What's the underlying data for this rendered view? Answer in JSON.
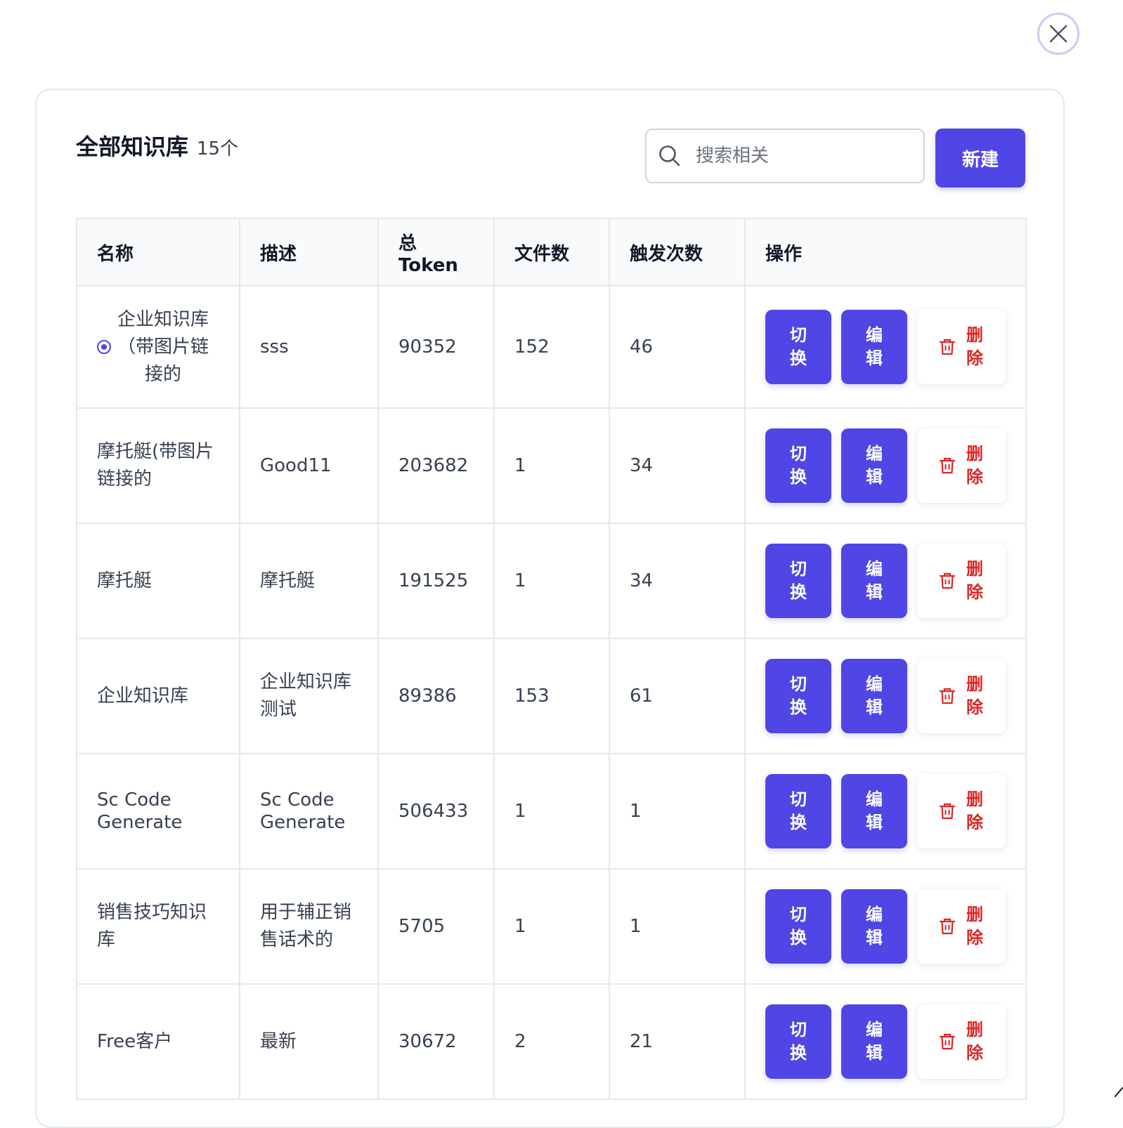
{
  "header": {
    "title": "全部知识库",
    "count": "15个"
  },
  "search": {
    "placeholder": "搜索相关"
  },
  "toolbar": {
    "new_label": "新建"
  },
  "icons": {
    "close": "close-icon",
    "search": "search-icon",
    "trash": "trash-icon",
    "radio": "radio-selected-icon"
  },
  "colors": {
    "accent": "#4f46e5",
    "danger": "#dc2626",
    "border": "#e5e7eb",
    "header_bg": "#f9fafb"
  },
  "table": {
    "columns": [
      "名称",
      "描述",
      "总Token",
      "文件数",
      "触发次数",
      "操作"
    ],
    "actions": {
      "switch_label": "切换",
      "edit_label": "编辑",
      "delete_label": "删除"
    },
    "rows": [
      {
        "name": "企业知识库（带图片链接的",
        "description": "sss",
        "tokens": "90352",
        "files": "152",
        "triggers": "46",
        "selected": true
      },
      {
        "name": "摩托艇(带图片链接的",
        "description": "Good11",
        "tokens": "203682",
        "files": "1",
        "triggers": "34",
        "selected": false
      },
      {
        "name": "摩托艇",
        "description": "摩托艇",
        "tokens": "191525",
        "files": "1",
        "triggers": "34",
        "selected": false
      },
      {
        "name": "企业知识库",
        "description": "企业知识库测试",
        "tokens": "89386",
        "files": "153",
        "triggers": "61",
        "selected": false
      },
      {
        "name": "Sc Code Generate",
        "description": "Sc Code Generate",
        "tokens": "506433",
        "files": "1",
        "triggers": "1",
        "selected": false
      },
      {
        "name": "销售技巧知识库",
        "description": "用于辅正销售话术的",
        "tokens": "5705",
        "files": "1",
        "triggers": "1",
        "selected": false
      },
      {
        "name": "Free客户",
        "description": "最新",
        "tokens": "30672",
        "files": "2",
        "triggers": "21",
        "selected": false
      }
    ]
  }
}
